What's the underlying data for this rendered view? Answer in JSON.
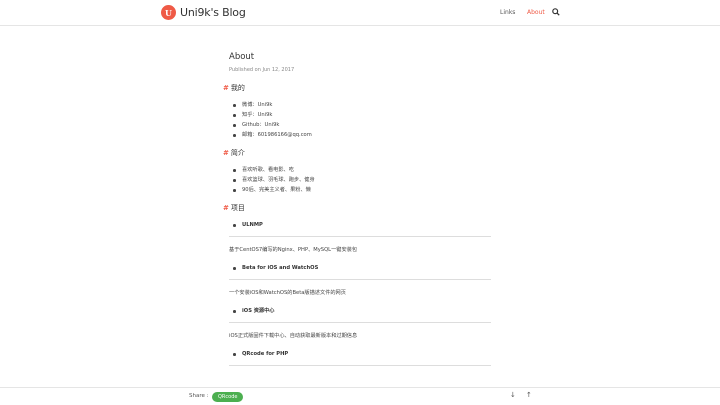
{
  "header": {
    "logo_glyph": "U",
    "site_title": "Uni9k's Blog",
    "nav": {
      "links": "Links",
      "about": "About"
    },
    "accent_color": "#ef5a46",
    "search_icon": "search-icon"
  },
  "post": {
    "title": "About",
    "published": "Published on Jun 12, 2017",
    "sections": {
      "me": {
        "heading": "我的",
        "items": [
          "微博：Uni9k",
          "知乎：Uni9k",
          "Github：Uni9k",
          "邮箱：601986166@qq.com"
        ]
      },
      "intro": {
        "heading": "简介",
        "items": [
          "喜欢听歌、看电影、吃",
          "喜欢篮球、羽毛球、跑步、健身",
          "90后、完美主义者、果粉、懒"
        ]
      },
      "projects": {
        "heading": "项目",
        "list": [
          {
            "name": "ULNMP",
            "desc": "基于CentOS7编写的Nginx、PHP、MySQL一键安装包"
          },
          {
            "name": "Beta for iOS and WatchOS",
            "desc": "一个安装iOS和WatchOS的Beta版描述文件的网页"
          },
          {
            "name": "iOS 资源中心",
            "desc": "iOS正式版固件下载中心、自动获取最新版本和过期信息"
          },
          {
            "name": "QRcode for PHP"
          }
        ]
      }
    }
  },
  "footer": {
    "share_label": "Share :",
    "qrcode_button": "QRcode",
    "qrcode_color": "#4caf50",
    "down_arrow": "↓",
    "up_arrow": "↑"
  }
}
